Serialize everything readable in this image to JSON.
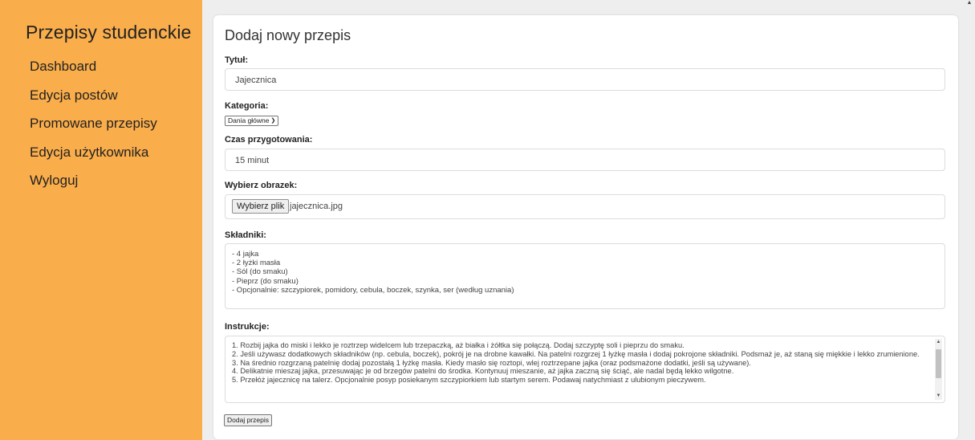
{
  "sidebar": {
    "brand": "Przepisy studenckie",
    "items": [
      {
        "label": "Dashboard"
      },
      {
        "label": "Edycja postów"
      },
      {
        "label": "Promowane przepisy"
      },
      {
        "label": "Edycja użytkownika"
      },
      {
        "label": "Wyloguj"
      }
    ]
  },
  "form": {
    "title": "Dodaj nowy przepis",
    "title_label": "Tytuł:",
    "title_value": "Jajecznica",
    "category_label": "Kategoria:",
    "category_value": "Dania główne",
    "prep_label": "Czas przygotowania:",
    "prep_value": "15 minut",
    "image_label": "Wybierz obrazek:",
    "file_button": "Wybierz plik",
    "file_name": "jajecznica.jpg",
    "ingredients_label": "Składniki:",
    "ingredients": [
      "- 4 jajka",
      "- 2 łyżki masła",
      "- Sól (do smaku)",
      "- Pieprz (do smaku)",
      "- Opcjonalnie: szczypiorek, pomidory, cebula, boczek, szynka, ser (według uznania)"
    ],
    "instructions_label": "Instrukcje:",
    "instructions": [
      "1. Rozbij jajka do miski i lekko je roztrzep widelcem lub trzepaczką, aż białka i żółtka się połączą. Dodaj szczyptę soli i pieprzu do smaku.",
      "2. Jeśli używasz dodatkowych składników (np. cebula, boczek), pokrój je na drobne kawałki. Na patelni rozgrzej 1 łyżkę masła i dodaj pokrojone składniki. Podsmaż je, aż staną się miękkie i lekko zrumienione.",
      "3. Na średnio rozgrzaną patelnię dodaj pozostałą 1 łyżkę masła. Kiedy masło się roztopi, wlej roztrzepane jajka (oraz podsmażone dodatki, jeśli są używane).",
      "4. Delikatnie mieszaj jajka, przesuwając je od brzegów patelni do środka. Kontynuuj mieszanie, aż jajka zaczną się ściąć, ale nadal będą lekko wilgotne.",
      "5. Przełóż jajecznicę na talerz. Opcjonalnie posyp posiekanym szczypiorkiem lub startym serem. Podawaj natychmiast z ulubionym pieczywem."
    ],
    "submit": "Dodaj przepis"
  },
  "icons": {
    "dropdown": "chevron-down-icon",
    "scroll_up": "triangle-up-icon",
    "scroll_down": "triangle-down-icon"
  }
}
